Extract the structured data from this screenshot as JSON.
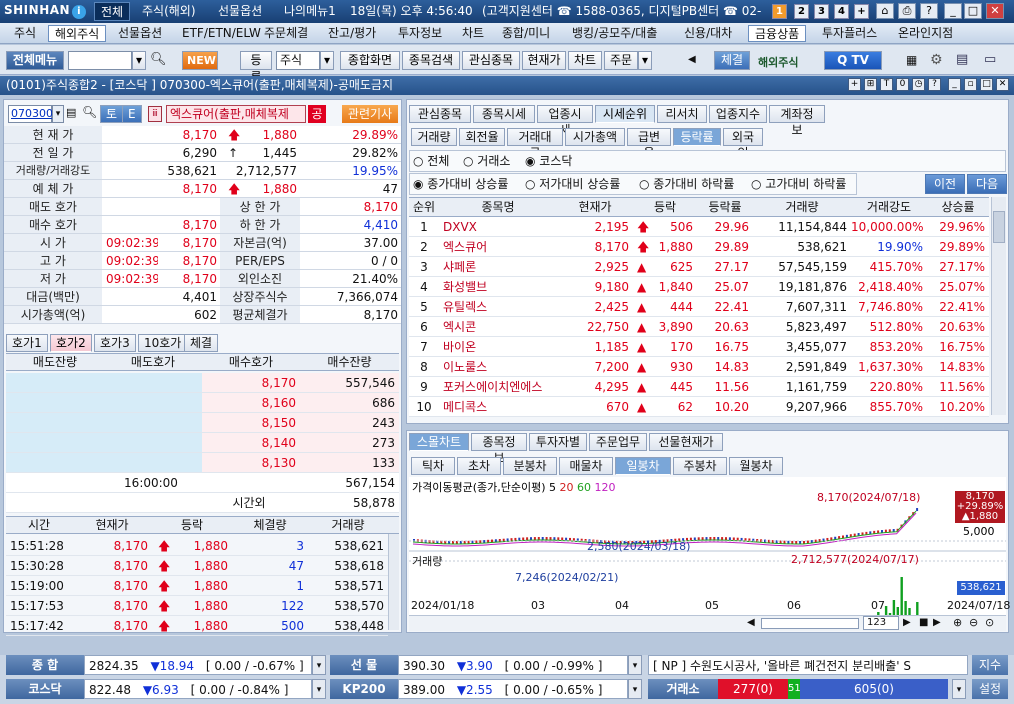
{
  "top": {
    "brand": "SHINHAN",
    "brand_icon": "i",
    "menus": [
      "전체",
      "주식(해외)",
      "선물옵션",
      "나의메뉴1"
    ],
    "datetime": "18일(목) 오후 4:56:40",
    "support": "(고객지원센터 ☎ 1588-0365, 디지털PB센터 ☎ 02-",
    "nums": [
      "1",
      "2",
      "3",
      "4"
    ]
  },
  "menubar": [
    "주식",
    "해외주식",
    "선물옵션",
    "ETF/ETN/ELW",
    "주문체결",
    "잔고/평가",
    "투자정보",
    "차트",
    "종합/미니",
    "뱅킹/공모주/대출",
    "신용/대차",
    "금융상품",
    "투자플러스",
    "온라인지점"
  ],
  "toolbar": {
    "menu_label": "전체메뉴",
    "new_label": "NEW",
    "reg_label": "등록",
    "stock_select": "주식",
    "search_btns": [
      "종합화면",
      "종목검색",
      "관심종목",
      "현재가",
      "차트",
      "주문"
    ],
    "fill_btn": "체결",
    "overseas": "해외주식",
    "tv": "Q TV"
  },
  "title": "(0101)주식종합2 - [코스닥 ] 070300-엑스큐어(출판,매체복제)-공매도금지",
  "left": {
    "code": "070300",
    "btn_to": "토",
    "btn_e": "E",
    "name": "엑스큐어(출판,매체복제",
    "btn_gong": "공",
    "news_btn": "관련기사",
    "rows": [
      {
        "label": "현 재 가",
        "v1": "8,170",
        "v2": "1,880",
        "v3": "29.89%"
      },
      {
        "label": "전 일 가",
        "v1": "6,290",
        "v2": "1,445",
        "v3": "29.82%"
      },
      {
        "label": "거래량/거래강도",
        "v1": "538,621",
        "v2": "2,712,577",
        "v3": "19.95%"
      },
      {
        "label": "예 체 가",
        "v1": "8,170",
        "v2": "1,880",
        "v3": "47"
      }
    ],
    "info": [
      {
        "l1": "매도 호가",
        "v1": "",
        "l2": "상 한 가",
        "v2": "8,170"
      },
      {
        "l1": "매수 호가",
        "v1": "8,170",
        "l2": "하 한 가",
        "v2": "4,410"
      },
      {
        "l1": "시      가",
        "t": "09:02:39",
        "v1": "8,170",
        "l2": "자본금(억)",
        "v2": "37.00"
      },
      {
        "l1": "고      가",
        "t": "09:02:39",
        "v1": "8,170",
        "l2": "PER/EPS",
        "v2": "0 / 0"
      },
      {
        "l1": "저      가",
        "t": "09:02:39",
        "v1": "8,170",
        "l2": "외인소진",
        "v2": "21.40%"
      },
      {
        "l1": "대금(백만)",
        "v1": "4,401",
        "l2": "상장주식수",
        "v2": "7,366,074"
      },
      {
        "l1": "시가총액(억)",
        "v1": "602",
        "l2": "평균체결가",
        "v2": "8,170"
      }
    ],
    "tabs": [
      "호가1",
      "호가2",
      "호가3",
      "10호가",
      "체결"
    ],
    "ob_headers": [
      "매도잔량",
      "매도호가",
      "매수호가",
      "매수잔량"
    ],
    "ob_rows": [
      [
        "8,170",
        "557,546"
      ],
      [
        "8,160",
        "686"
      ],
      [
        "8,150",
        "243"
      ],
      [
        "8,140",
        "273"
      ],
      [
        "8,130",
        "133"
      ]
    ],
    "ob_time": "16:00:00",
    "ob_total": "567,154",
    "ob_after_label": "시간외",
    "ob_after": "58,878",
    "tick_headers": [
      "시간",
      "현재가",
      "등락",
      "체결량",
      "거래량"
    ],
    "ticks": [
      [
        "15:51:28",
        "8,170",
        "1,880",
        "3",
        "538,621"
      ],
      [
        "15:30:28",
        "8,170",
        "1,880",
        "47",
        "538,618"
      ],
      [
        "15:19:00",
        "8,170",
        "1,880",
        "1",
        "538,571"
      ],
      [
        "15:17:53",
        "8,170",
        "1,880",
        "122",
        "538,570"
      ],
      [
        "15:17:42",
        "8,170",
        "1,880",
        "500",
        "538,448"
      ]
    ]
  },
  "right": {
    "tabs1": [
      "관심종목",
      "종목시세",
      "업종시세",
      "시세순위",
      "리서치",
      "업종지수",
      "계좌정보"
    ],
    "tabs2": [
      "거래량",
      "회전율",
      "거래대금",
      "시가총액",
      "급변율",
      "등락률",
      "외국인"
    ],
    "market": [
      "전체",
      "거래소",
      "코스닥"
    ],
    "sort": [
      "종가대비 상승률",
      "저가대비 상승률",
      "종가대비 하락률",
      "고가대비 하락률"
    ],
    "prev": "이전",
    "next": "다음",
    "headers": [
      "순위",
      "종목명",
      "현재가",
      "등락",
      "등락률",
      "거래량",
      "거래강도",
      "상승률"
    ],
    "rows": [
      [
        "1",
        "DXVX",
        "2,195",
        "506",
        "29.96",
        "11,154,844",
        "10,000.00%",
        "29.96%"
      ],
      [
        "2",
        "엑스큐어",
        "8,170",
        "1,880",
        "29.89",
        "538,621",
        "19.90%",
        "29.89%"
      ],
      [
        "3",
        "샤페론",
        "2,925",
        "625",
        "27.17",
        "57,545,159",
        "415.70%",
        "27.17%"
      ],
      [
        "4",
        "화성밸브",
        "9,180",
        "1,840",
        "25.07",
        "19,181,876",
        "2,418.40%",
        "25.07%"
      ],
      [
        "5",
        "유틸렉스",
        "2,425",
        "444",
        "22.41",
        "7,607,311",
        "7,746.80%",
        "22.41%"
      ],
      [
        "6",
        "엑시콘",
        "22,750",
        "3,890",
        "20.63",
        "5,823,497",
        "512.80%",
        "20.63%"
      ],
      [
        "7",
        "바이온",
        "1,185",
        "170",
        "16.75",
        "3,455,077",
        "853.20%",
        "16.75%"
      ],
      [
        "8",
        "이노룰스",
        "7,200",
        "930",
        "14.83",
        "2,591,849",
        "1,637.30%",
        "14.83%"
      ],
      [
        "9",
        "포커스에이치엔에스",
        "4,295",
        "445",
        "11.56",
        "1,161,759",
        "220.80%",
        "11.56%"
      ],
      [
        "10",
        "메디콕스",
        "670",
        "62",
        "10.20",
        "9,207,966",
        "855.70%",
        "10.20%"
      ]
    ]
  },
  "chart": {
    "tabs1": [
      "스몰차트",
      "종목정보",
      "투자자별",
      "주문업무",
      "선물현재가"
    ],
    "tabs2": [
      "틱차트",
      "초차트",
      "분봉차트",
      "매물차트",
      "일봉차트",
      "주봉차트",
      "월봉차트"
    ],
    "ma_label": "가격이동평균(종가,단순이평) 5",
    "ma": [
      "20",
      "60",
      "120"
    ],
    "high_label": "8,170(2024/07/18)",
    "low_label": "2,580(2024/03/18)",
    "y_label": "5,000",
    "side_pct": "+29.89%",
    "side_chg": "▲1,880",
    "side_val": "8,170",
    "vol_label": "거래량",
    "vol_high": "2,712,577(2024/07/17)",
    "vol_low": "7,246(2024/02/21)",
    "vol_side": "538,621",
    "xaxis": [
      "2024/01/18",
      "03",
      "04",
      "05",
      "06",
      "07",
      "2024/07/18"
    ],
    "zoom": "123"
  },
  "status": {
    "r1": [
      {
        "label": "종 합",
        "val": "2824.35",
        "chg": "▼18.94",
        "pct": "[ 0.00 / -0.67% ]"
      },
      {
        "label": "선 물",
        "val": "390.30",
        "chg": "▼3.90",
        "pct": "[ 0.00 / -0.99% ]"
      }
    ],
    "r2": [
      {
        "label": "코스닥",
        "val": "822.48",
        "chg": "▼6.93",
        "pct": "[ 0.00 / -0.84% ]"
      },
      {
        "label": "KP200",
        "val": "389.00",
        "chg": "▼2.55",
        "pct": "[ 0.00 / -0.65% ]"
      }
    ],
    "news": "[ NP ] 수원도시공사, '올바른 폐건전지 분리배출' S",
    "index_btn": "지수",
    "settings_btn": "설정",
    "krx_label": "거래소",
    "krx_up": "277(0)",
    "krx_flat": "51",
    "krx_down": "605(0)"
  }
}
